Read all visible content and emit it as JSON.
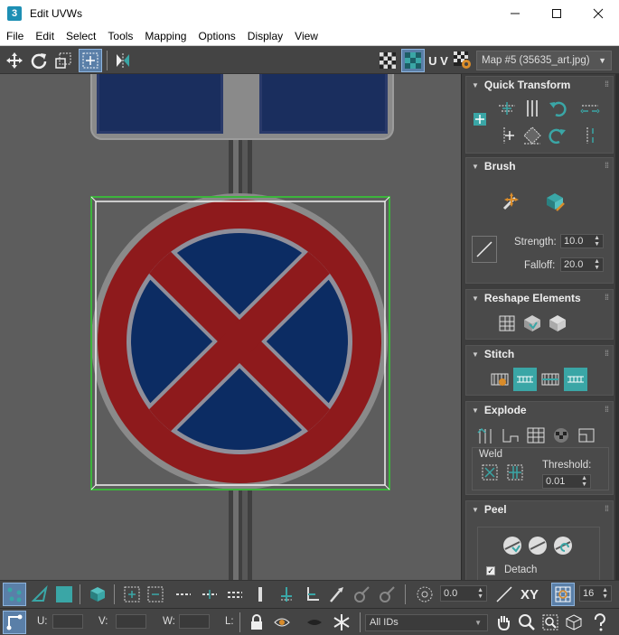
{
  "window": {
    "app_icon": "3",
    "title": "Edit UVWs",
    "controls": [
      "minimize-icon",
      "maximize-icon",
      "close-icon"
    ]
  },
  "menubar": {
    "items": [
      "File",
      "Edit",
      "Select",
      "Tools",
      "Mapping",
      "Options",
      "Display",
      "View"
    ]
  },
  "toolbar": {
    "uv_label": "U V",
    "map_select": "Map #5 (35635_art.jpg)"
  },
  "panel": {
    "quick_transform": {
      "title": "Quick Transform"
    },
    "brush": {
      "title": "Brush",
      "strength_label": "Strength:",
      "strength_value": "10.0",
      "falloff_label": "Falloff:",
      "falloff_value": "20.0"
    },
    "reshape": {
      "title": "Reshape Elements"
    },
    "stitch": {
      "title": "Stitch"
    },
    "explode": {
      "title": "Explode",
      "weld_label": "Weld",
      "threshold_label": "Threshold:",
      "threshold_value": "0.01"
    },
    "peel": {
      "title": "Peel",
      "detach_label": "Detach",
      "detach_checked": true
    }
  },
  "bottom_toolbar": {
    "rotate_value": "0.0",
    "xy_label": "XY",
    "grid_value": "16",
    "u_label": "U:",
    "v_label": "V:",
    "w_label": "W:",
    "l_label": "L:",
    "id_select": "All IDs"
  },
  "colors": {
    "accent": "#3aa6a6",
    "active_blue": "#5a7fa8",
    "sign_red": "#8e1a1c",
    "sign_blue": "#0c2c63",
    "selection_green": "#3cb43c"
  }
}
